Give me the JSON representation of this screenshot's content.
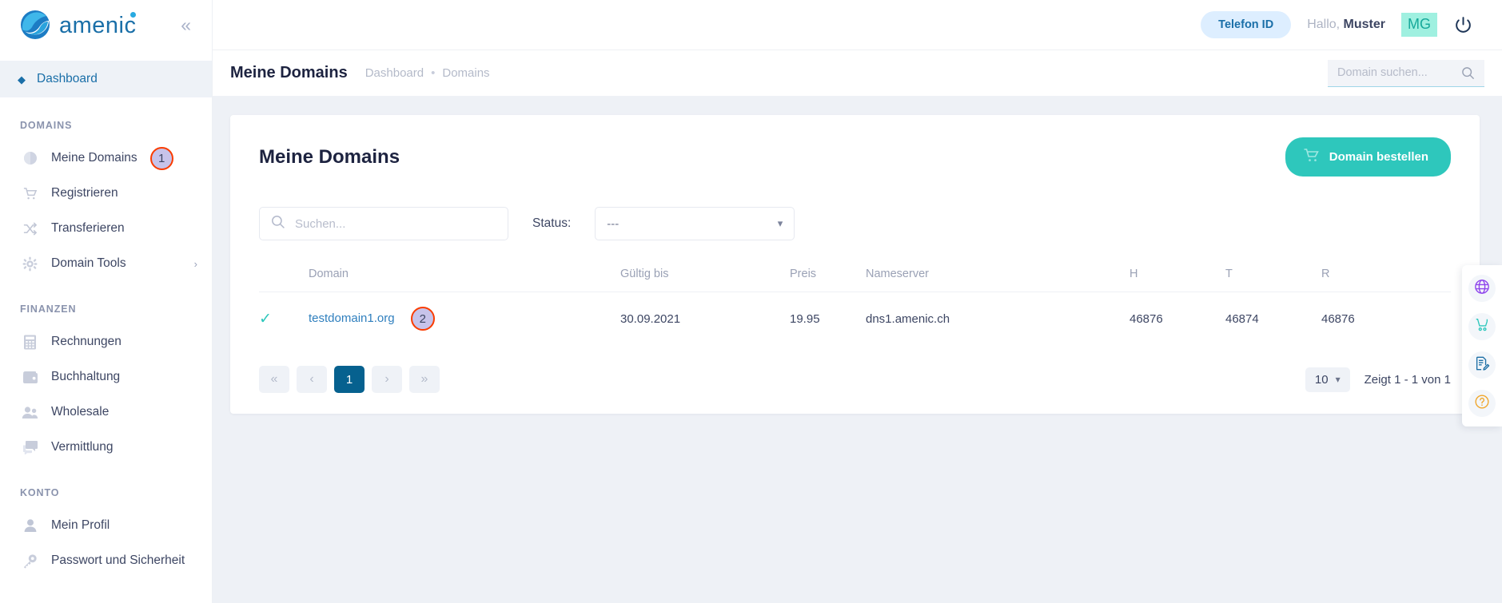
{
  "brand": {
    "name": "amenic",
    "collapse_icon": "chevron-double-left"
  },
  "sidebar": {
    "dashboard": {
      "label": "Dashboard",
      "icon": "diamond-icon"
    },
    "sections": [
      {
        "title": "DOMAINS",
        "items": [
          {
            "label": "Meine Domains",
            "icon": "globe-icon",
            "badge": "1"
          },
          {
            "label": "Registrieren",
            "icon": "cart-icon"
          },
          {
            "label": "Transferieren",
            "icon": "transfer-icon"
          },
          {
            "label": "Domain Tools",
            "icon": "gear-icon",
            "chevron": "›"
          }
        ]
      },
      {
        "title": "FINANZEN",
        "items": [
          {
            "label": "Rechnungen",
            "icon": "calculator-icon"
          },
          {
            "label": "Buchhaltung",
            "icon": "wallet-icon"
          },
          {
            "label": "Wholesale",
            "icon": "users-icon"
          },
          {
            "label": "Vermittlung",
            "icon": "chat-icon"
          }
        ]
      },
      {
        "title": "KONTO",
        "items": [
          {
            "label": "Mein Profil",
            "icon": "user-icon"
          },
          {
            "label": "Passwort und Sicherheit",
            "icon": "key-icon"
          }
        ]
      }
    ]
  },
  "topbar": {
    "telefon_id": "Telefon ID",
    "greeting_prefix": "Hallo, ",
    "user_name": "Muster",
    "avatar_initials": "MG",
    "power_icon": "power-icon"
  },
  "page_header": {
    "title": "Meine Domains",
    "breadcrumbs": [
      "Dashboard",
      "Domains"
    ],
    "separator": "•",
    "search_placeholder": "Domain suchen...",
    "search_value": ""
  },
  "card": {
    "title": "Meine Domains",
    "order_button": "Domain bestellen",
    "order_button_icon": "cart-icon",
    "filters": {
      "search_placeholder": "Suchen...",
      "search_value": "",
      "status_label": "Status:",
      "status_value": "---",
      "status_options": [
        "---"
      ]
    },
    "table": {
      "headers": [
        "",
        "Domain",
        "Gültig bis",
        "Preis",
        "Nameserver",
        "H",
        "T",
        "R"
      ],
      "rows": [
        {
          "selected_icon": "check-icon",
          "domain": "testdomain1.org",
          "badge": "2",
          "gueltig_bis": "30.09.2021",
          "preis": "19.95",
          "nameserver": "dns1.amenic.ch",
          "h": "46876",
          "t": "46874",
          "r": "46876"
        }
      ]
    },
    "pagination": {
      "first": "«",
      "prev": "‹",
      "pages": [
        "1"
      ],
      "current_page": "1",
      "next": "›",
      "last": "»",
      "per_page": "10",
      "showing": "Zeigt 1 - 1 von 1"
    }
  },
  "float_tools": [
    {
      "icon": "globe-icon",
      "color": "#8e44ec"
    },
    {
      "icon": "cart-icon",
      "color": "#2ec7bc"
    },
    {
      "icon": "document-edit-icon",
      "color": "#1d6fa5"
    },
    {
      "icon": "help-icon",
      "color": "#f0a62a"
    }
  ],
  "colors": {
    "brand_blue": "#1a6fa8",
    "teal": "#2ec7bc",
    "pager_active": "#06618f",
    "annotation_ring": "#fa3c00",
    "annotation_fill": "#c7c3ea"
  }
}
